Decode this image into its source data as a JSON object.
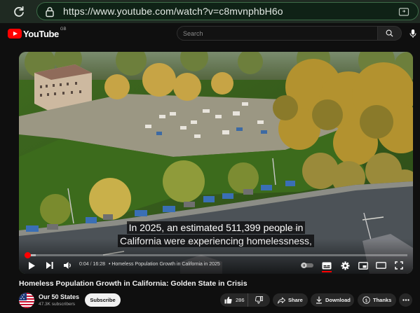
{
  "browser": {
    "url": "https://www.youtube.com/watch?v=c8mvnphbH6o"
  },
  "header": {
    "logo_text": "YouTube",
    "region": "GB",
    "search_placeholder": "Search"
  },
  "player": {
    "captions": [
      "In 2025, an estimated 511,399 people in",
      "California were experiencing homelessness,"
    ],
    "current_time": "0:04",
    "duration": "16:28",
    "chapter": "• Homeless Population Growth in California in 2025",
    "played_fraction": 0.004,
    "buffered_fraction": 0.03
  },
  "video": {
    "title": "Homeless Population Growth in California: Golden State in Crisis"
  },
  "channel": {
    "name": "Our 50 States",
    "subscribers": "47.3K subscribers",
    "subscribe_label": "Subscribe"
  },
  "actions": {
    "likes": "286",
    "share_label": "Share",
    "download_label": "Download",
    "thanks_label": "Thanks"
  },
  "colors": {
    "accent": "#ff0000",
    "browser_frame": "#1f2a22"
  }
}
